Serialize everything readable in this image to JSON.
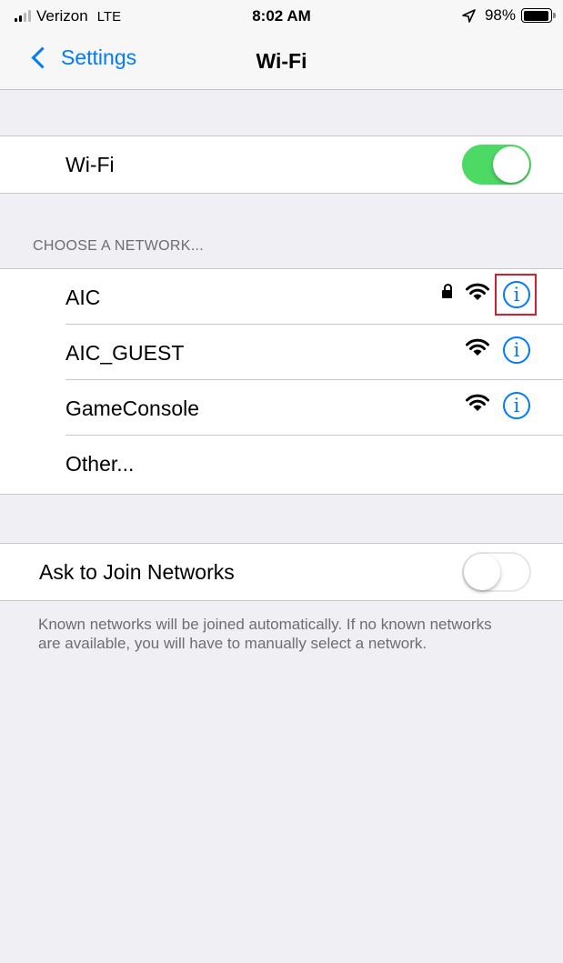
{
  "status_bar": {
    "carrier": "Verizon",
    "network_type": "LTE",
    "time": "8:02 AM",
    "location_icon": "location-arrow-icon",
    "battery_percent": "98%",
    "battery_level": 0.98,
    "signal_bars_active": 2,
    "signal_bars_total": 4
  },
  "nav": {
    "back_label": "Settings",
    "title": "Wi-Fi"
  },
  "wifi_toggle": {
    "label": "Wi-Fi",
    "state": "on"
  },
  "networks_section": {
    "header": "CHOOSE A NETWORK...",
    "networks": [
      {
        "name": "AIC",
        "secured": true,
        "info_icon": "info-icon",
        "highlighted": true
      },
      {
        "name": "AIC_GUEST",
        "secured": false,
        "info_icon": "info-icon",
        "highlighted": false
      },
      {
        "name": "GameConsole",
        "secured": false,
        "info_icon": "info-icon",
        "highlighted": false
      }
    ],
    "other_label": "Other..."
  },
  "ask_to_join": {
    "label": "Ask to Join Networks",
    "state": "off",
    "footer": "Known networks will be joined automatically. If no known networks are available, you will have to manually select a network."
  },
  "colors": {
    "accent": "#007aff",
    "toggle_on": "#4cd964",
    "highlight_box": "#d0202e",
    "background": "#efeff4"
  }
}
